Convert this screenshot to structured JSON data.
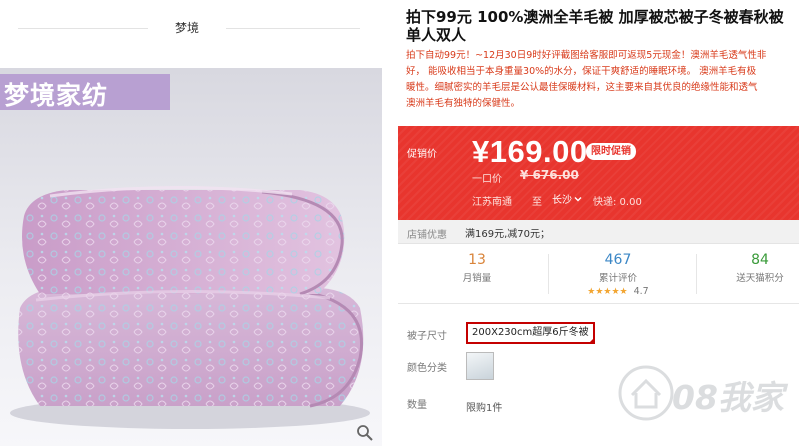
{
  "store": {
    "name": "梦境"
  },
  "gallery": {
    "brand_banner": "梦境家纺",
    "zoom_icon": "magnifier-icon"
  },
  "product": {
    "title_line1": "拍下99元 100%澳洲全羊毛被 加厚被芯被子冬被春秋被",
    "title_line2": "单人双人",
    "subtitle_lines": [
      "拍下自动99元！~12月30日9时好评截图给客服即可返现5元现金！澳洲羊毛透气性非",
      "好， 能吸收相当于本身重量30%的水分，保证干爽舒适的睡眠环境。 澳洲羊毛有极",
      "暖性。细腻密实的羊毛层是公认最佳保暖材料，这主要来自其优良的绝缘性能和透气",
      "澳洲羊毛有独特的保健性。"
    ]
  },
  "price": {
    "promo_label": "促销价",
    "current": "¥169.00",
    "badge": "限时促销",
    "orig_label": "一口价",
    "orig_value": "¥ 676.00",
    "ship_from": "江苏南通",
    "ship_to_label": "至",
    "ship_city": "长沙",
    "fee": "快递: 0.00"
  },
  "coupon": {
    "label": "店铺优惠",
    "text": "满169元,减70元；"
  },
  "stats": {
    "monthly_sales": {
      "value": "13",
      "label": "月销量"
    },
    "reviews": {
      "value": "467",
      "label": "累计评价",
      "stars": "★★★★★",
      "score": "4.7"
    },
    "points": {
      "value": "84",
      "label": "送天猫积分"
    }
  },
  "options": {
    "size_label": "被子尺寸",
    "size_value": "200X230cm超厚6斤冬被",
    "color_label": "颜色分类",
    "qty_label": "数量",
    "qty_limit": "限购1件"
  },
  "watermark": {
    "text": "08我家"
  },
  "colors": {
    "price_red": "#e8352e",
    "banner_lilac": "#b8a0d2",
    "sales_orange": "#d9843a",
    "reviews_blue": "#3b87c6",
    "points_green": "#3a9b3a",
    "star_gold": "#f2a531",
    "chip_red": "#c40000"
  }
}
